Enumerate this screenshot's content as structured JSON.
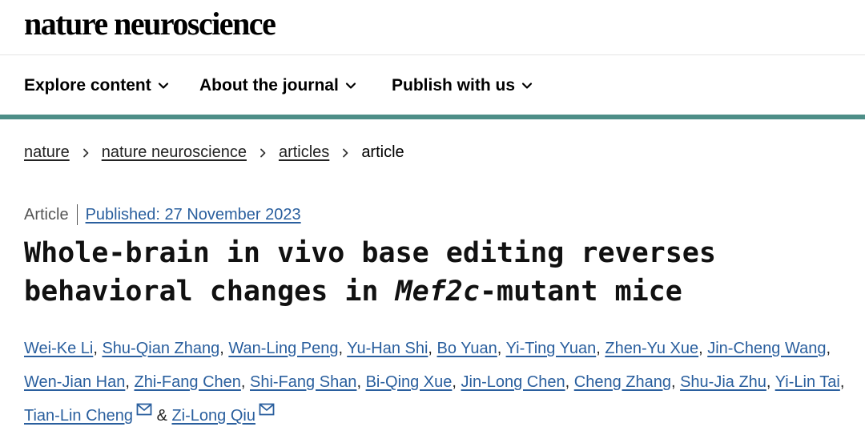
{
  "site": {
    "brand": "nature neuroscience"
  },
  "nav": {
    "items": [
      {
        "label": "Explore content"
      },
      {
        "label": "About the journal"
      },
      {
        "label": "Publish with us"
      }
    ]
  },
  "breadcrumb": {
    "items": [
      "nature",
      "nature neuroscience",
      "articles"
    ],
    "current": "article"
  },
  "article": {
    "type": "Article",
    "published": "Published: 27 November 2023",
    "title_part1": "Whole-brain in vivo base editing reverses behavioral changes in ",
    "title_gene": "Mef2c",
    "title_part2": "-mutant mice",
    "authors": [
      "Wei-Ke Li",
      "Shu-Qian Zhang",
      "Wan-Ling Peng",
      "Yu-Han Shi",
      "Bo Yuan",
      "Yi-Ting Yuan",
      "Zhen-Yu Xue",
      "Jin-Cheng Wang",
      "Wen-Jian Han",
      "Zhi-Fang Chen",
      "Shi-Fang Shan",
      "Bi-Qing Xue",
      "Jin-Long Chen",
      "Cheng Zhang",
      "Shu-Jia Zhu",
      "Yi-Lin Tai",
      "Tian-Lin Cheng",
      "Zi-Long Qiu"
    ],
    "separator": ", ",
    "ampersand": "&"
  },
  "icons": {
    "chevron": "chevron-down-icon",
    "breadcrumb_separator": "chevron-right-icon",
    "corresponding_author": "mail-icon"
  },
  "colors": {
    "accent_rule": "#4d8e87",
    "link": "#2a5f9e"
  }
}
